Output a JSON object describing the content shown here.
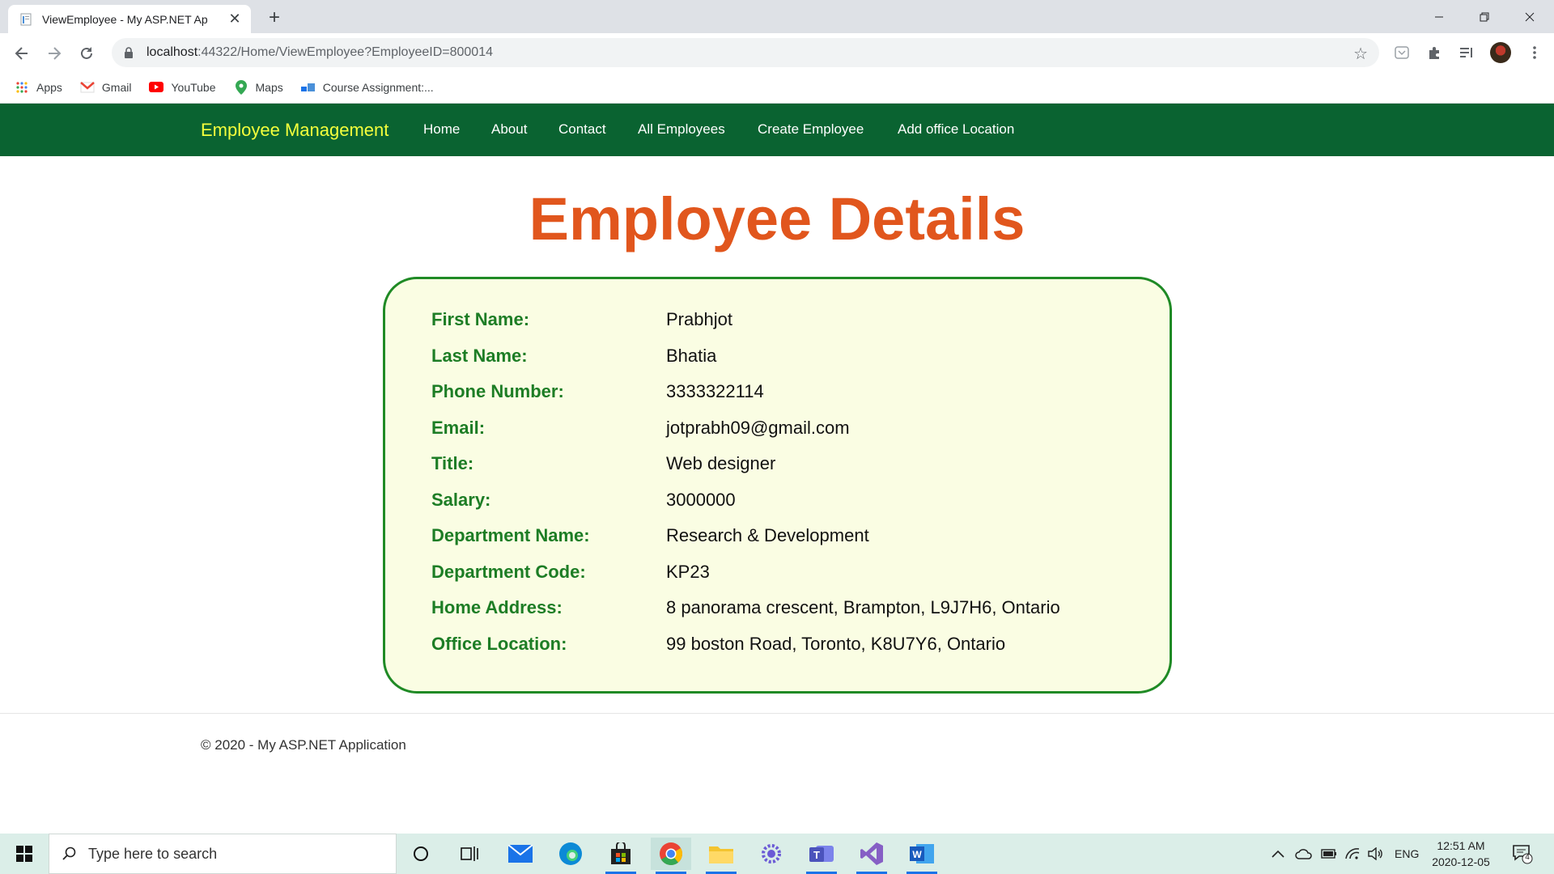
{
  "browser": {
    "tab_title": "ViewEmployee - My ASP.NET Ap",
    "tab_close": "✕",
    "new_tab": "+",
    "url_host": "localhost",
    "url_path": ":44322/Home/ViewEmployee?EmployeeID=800014",
    "bookmarks": [
      {
        "label": "Apps",
        "icon": "apps-grid-icon"
      },
      {
        "label": "Gmail",
        "icon": "gmail-icon"
      },
      {
        "label": "YouTube",
        "icon": "youtube-icon"
      },
      {
        "label": "Maps",
        "icon": "maps-icon"
      },
      {
        "label": "Course Assignment:...",
        "icon": "course-icon"
      }
    ]
  },
  "nav": {
    "brand": "Employee Management",
    "links": [
      "Home",
      "About",
      "Contact",
      "All Employees",
      "Create Employee",
      "Add office Location"
    ]
  },
  "page": {
    "heading": "Employee Details",
    "fields": [
      {
        "label": "First Name:",
        "value": "Prabhjot"
      },
      {
        "label": "Last Name:",
        "value": "Bhatia"
      },
      {
        "label": "Phone Number:",
        "value": "3333322114"
      },
      {
        "label": "Email:",
        "value": "jotprabh09@gmail.com"
      },
      {
        "label": "Title:",
        "value": "Web designer"
      },
      {
        "label": "Salary:",
        "value": "3000000"
      },
      {
        "label": "Department Name:",
        "value": "Research & Development"
      },
      {
        "label": "Department Code:",
        "value": "KP23"
      },
      {
        "label": "Home Address:",
        "value": "8 panorama crescent, Brampton, L9J7H6, Ontario"
      },
      {
        "label": "Office Location:",
        "value": "99 boston Road, Toronto, K8U7Y6, Ontario"
      }
    ],
    "footer": "© 2020 - My ASP.NET Application"
  },
  "taskbar": {
    "search_placeholder": "Type here to search",
    "language": "ENG",
    "time": "12:51 AM",
    "date": "2020-12-05",
    "notification_count": "4"
  },
  "colors": {
    "navbar": "#0a6331",
    "brand": "#f4ff3c",
    "heading": "#e1561d",
    "card_bg": "#fafde3",
    "card_border": "#1f8a25",
    "label": "#1d7d25"
  }
}
